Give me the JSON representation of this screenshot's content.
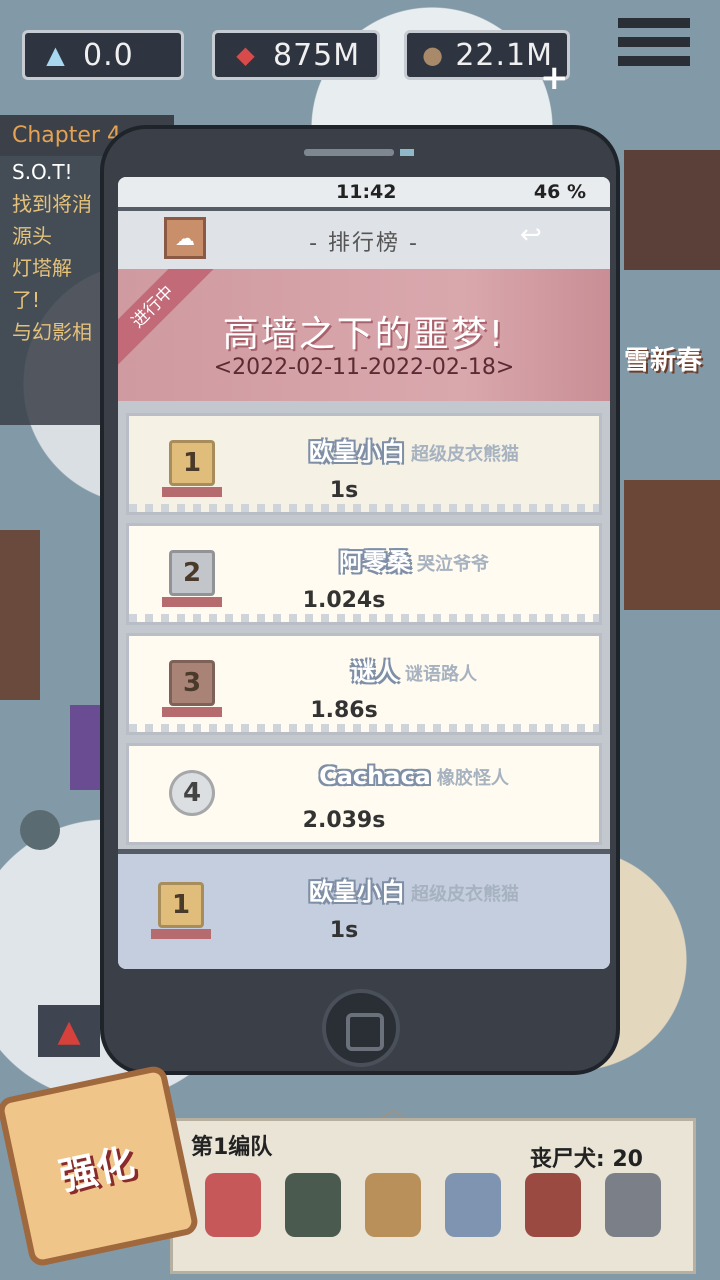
{
  "currencies": [
    {
      "icon": "crystal-icon",
      "value": "0.0"
    },
    {
      "icon": "gem-icon",
      "value": "875M"
    },
    {
      "icon": "coin-icon",
      "value": "22.1M"
    }
  ],
  "quest_panel": {
    "chapter": "Chapter 4",
    "lines": [
      "S.O.T!",
      "找到将消",
      "源头",
      "灯塔解",
      "了!",
      "与幻影相"
    ]
  },
  "right_sign": "雪新春",
  "phone": {
    "status": {
      "time": "11:42",
      "battery": "46 %"
    },
    "title": "- 排行榜 -",
    "event": {
      "badge": "进行中",
      "title": "高墙之下的噩梦!",
      "date": "<2022-02-11-2022-02-18>"
    },
    "leaderboard": [
      {
        "rank": "1",
        "name": "欧皇小白",
        "title": "超级皮衣熊猫",
        "time": "1s"
      },
      {
        "rank": "2",
        "name": "阿零桑",
        "title": "哭泣爷爷",
        "time": "1.024s"
      },
      {
        "rank": "3",
        "name": "谜人",
        "title": "谜语路人",
        "time": "1.86s"
      },
      {
        "rank": "4",
        "name": "Cachaca",
        "title": "橡胶怪人",
        "time": "2.039s"
      }
    ],
    "my_rank": {
      "rank": "1",
      "name": "欧皇小白",
      "title": "超级皮衣熊猫",
      "time": "1s"
    }
  },
  "team": {
    "name": "第1编队",
    "info": "丧尸犬: 20"
  },
  "upgrade_label": "强化",
  "colors": {
    "accent": "#cf9aa0",
    "panel": "#3a3f48"
  }
}
